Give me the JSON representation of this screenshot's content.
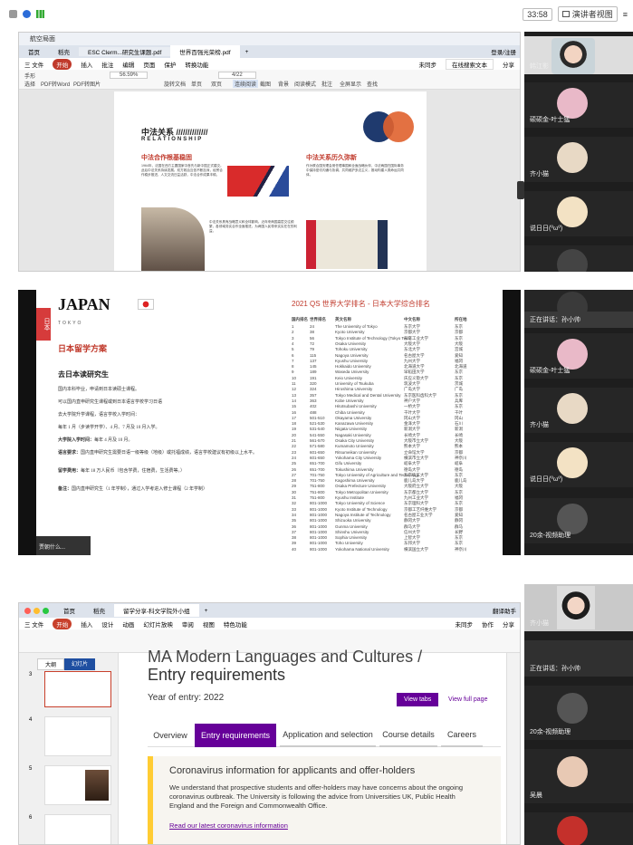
{
  "status": {
    "time": "33:58",
    "right_label": "演讲者视图"
  },
  "panel1": {
    "app_header": {
      "win_title": "航空局面",
      "tabs": [
        "首页",
        "稻壳",
        "ESC Clerm...研究生课题.pdf",
        "世界百强光荣榜.pdf"
      ],
      "right_btn": "登录/注册"
    },
    "menu": [
      "三 文件",
      "开始",
      "插入",
      "批注",
      "编辑",
      "页面",
      "保护",
      "转换功能"
    ],
    "menu_active": "开始",
    "menu_right": [
      "未同步",
      "在线搜索文本",
      "分享"
    ],
    "ribbon_left": [
      "手形",
      "选择",
      "PDF转Word",
      "PDF转图片"
    ],
    "zoom": "56.59%",
    "page_indicator": "4/22",
    "ribbon_right": [
      "旋转文档",
      "单页",
      "双页",
      "连续阅读",
      "截图",
      "背景",
      "阅读模式",
      "批注",
      "全屏显示",
      "查找"
    ],
    "doc": {
      "heading": "中法关系 //////////////",
      "subheading": "RELATIONSHIP",
      "col1_title": "中法合作根基稳固",
      "col1_text": "1964年，法国在西方主要国家中首先与新中国正式建交。此后中法关系持续发展。双方政治互信不断加深，经贸合作稳步推进，人文交流日益活跃，中法合作成果丰硕。",
      "col2_title": "中法关系历久弥新",
      "col2_text": "作为联合国安理会常任理事国和全面战略伙伴，中法两国在国际事务中保持密切沟通与协调，共同维护多边主义，推动构建人类命运共同体。",
      "bottom_text": "中法关系具有战略意义和全球影响。近年来两国高层交往频繁，各领域务实合作全面推进，为两国人民带来实实在在的利益。"
    },
    "participants": [
      {
        "name": "韩江影",
        "self": true
      },
      {
        "name": "硕硕金-叶士猛"
      },
      {
        "name": "齐小猫"
      },
      {
        "name": "说日日(ºωº)"
      }
    ]
  },
  "panel2": {
    "left": {
      "country": "JAPAN",
      "sub": "TOKYO",
      "side_label": "日本",
      "section": "日本留学方案",
      "h2": "去日本读研究生",
      "p1": "国内本科毕业，申请到日本读硕士课程。",
      "p2": "可以国内直申研究生课程或到日本语言学校学习日语",
      "p3": "去大学院升学课程，语言学校入学时间：",
      "p4": "每年 1 月（步读学开学）、4 月、7 月及 10 月入学。",
      "p5_label": "大学院入学时间：",
      "p5": "每年 4 月及 10 月。",
      "p6_label": "语言要求：",
      "p6": "国内直申研究生需要日语一级等级（地级）或托福成绩，语言学校建议有初级以上水平。",
      "p7_label": "留学费用：",
      "p7": "每年 18 万人民币（包含学费，住宿费，生活费等。）",
      "p8_label": "备注：",
      "p8": "国内直申研究生（1 年学制），通过入学考进入修士课程（2 年学制）",
      "speaker": "贾朝什么..."
    },
    "right": {
      "title": "2021 QS 世界大学排名 - 日本大学综合排名",
      "headers": [
        "国内排名",
        "世界排名",
        "英文名称",
        "中文名称",
        "所在地"
      ],
      "rows": [
        [
          "1",
          "24",
          "The University of Tokyo",
          "东京大学",
          "东京"
        ],
        [
          "2",
          "38",
          "Kyoto University",
          "京都大学",
          "京都"
        ],
        [
          "3",
          "56",
          "Tokyo Institute of Technology (Tokyo Tech)",
          "东京工业大学",
          "东京"
        ],
        [
          "4",
          "72",
          "Osaka University",
          "大阪大学",
          "大阪"
        ],
        [
          "5",
          "79",
          "Tohoku University",
          "东北大学",
          "宫城"
        ],
        [
          "6",
          "115",
          "Nagoya University",
          "名古屋大学",
          "爱知"
        ],
        [
          "7",
          "137",
          "Kyushu University",
          "九州大学",
          "福冈"
        ],
        [
          "8",
          "145",
          "Hokkaido University",
          "北海道大学",
          "北海道"
        ],
        [
          "9",
          "189",
          "Waseda University",
          "早稻田大学",
          "东京"
        ],
        [
          "10",
          "191",
          "Keio University",
          "庆应义塾大学",
          "东京"
        ],
        [
          "11",
          "320",
          "University of Tsukuba",
          "筑波大学",
          "茨城"
        ],
        [
          "12",
          "324",
          "Hiroshima University",
          "广岛大学",
          "广岛"
        ],
        [
          "13",
          "357",
          "Tokyo Medical and Dental University",
          "东京医科齿科大学",
          "东京"
        ],
        [
          "14",
          "363",
          "Kobe University",
          "神户大学",
          "兵库"
        ],
        [
          "15",
          "402",
          "Hitotsubashi University",
          "一桥大学",
          "东京"
        ],
        [
          "16",
          "488",
          "Chiba University",
          "千叶大学",
          "千叶"
        ],
        [
          "17",
          "501-510",
          "Okayama University",
          "冈山大学",
          "冈山"
        ],
        [
          "18",
          "521-530",
          "Kanazawa University",
          "金泽大学",
          "石川"
        ],
        [
          "19",
          "531-540",
          "Niigata University",
          "新潟大学",
          "新潟"
        ],
        [
          "20",
          "541-550",
          "Nagasaki University",
          "长崎大学",
          "长崎"
        ],
        [
          "21",
          "561-570",
          "Osaka City University",
          "大阪市立大学",
          "大阪"
        ],
        [
          "22",
          "571-580",
          "Kumamoto University",
          "熊本大学",
          "熊本"
        ],
        [
          "23",
          "601-650",
          "Ritsumeikan University",
          "立命馆大学",
          "京都"
        ],
        [
          "24",
          "601-650",
          "Yokohama City University",
          "横滨市立大学",
          "神奈川"
        ],
        [
          "25",
          "651-700",
          "Gifu University",
          "岐阜大学",
          "岐阜"
        ],
        [
          "26",
          "651-700",
          "Tokushima University",
          "德岛大学",
          "德岛"
        ],
        [
          "27",
          "701-750",
          "Tokyo University of Agriculture and Technology",
          "东京农工大学",
          "东京"
        ],
        [
          "28",
          "701-750",
          "Kagoshima University",
          "鹿儿岛大学",
          "鹿儿岛"
        ],
        [
          "29",
          "751-800",
          "Osaka Prefecture University",
          "大阪府立大学",
          "大阪"
        ],
        [
          "30",
          "751-800",
          "Tokyo Metropolitan University",
          "东京都立大学",
          "东京"
        ],
        [
          "31",
          "751-800",
          "Kyushu Institute",
          "九州工业大学",
          "福冈"
        ],
        [
          "32",
          "801-1000",
          "Tokyo University of Science",
          "东京理科大学",
          "东京"
        ],
        [
          "33",
          "801-1000",
          "Kyoto Institute of Technology",
          "京都工艺纤维大学",
          "京都"
        ],
        [
          "34",
          "801-1000",
          "Nagoya Institute of Technology",
          "名古屋工业大学",
          "爱知"
        ],
        [
          "35",
          "801-1000",
          "Shizuoka University",
          "静冈大学",
          "静冈"
        ],
        [
          "36",
          "801-1000",
          "Gunma University",
          "群马大学",
          "群马"
        ],
        [
          "37",
          "801-1000",
          "Shinshu University",
          "信州大学",
          "长野"
        ],
        [
          "38",
          "801-1000",
          "Sophia University",
          "上智大学",
          "东京"
        ],
        [
          "39",
          "801-1000",
          "Toho University",
          "东邦大学",
          "东京"
        ],
        [
          "40",
          "801-1000",
          "Yokohama National University",
          "横滨国立大学",
          "神奈川"
        ]
      ]
    },
    "participants": [
      {
        "name": "正在讲话：孙小帅"
      },
      {
        "name": "硕硕金-叶士猛"
      },
      {
        "name": "齐小猫"
      },
      {
        "name": "说日日(ºωº)"
      },
      {
        "name": "20余-视频助理"
      }
    ]
  },
  "panel3": {
    "app_header": {
      "tabs": [
        "首页",
        "稻壳",
        "留学分享-科文学院外小组"
      ],
      "right_btn": "翻译助手"
    },
    "menu": [
      "三 文件",
      "开始",
      "插入",
      "设计",
      "动画",
      "幻灯片放映",
      "审阅",
      "视图",
      "特色功能"
    ],
    "menu_active": "开始",
    "menu_right": [
      "未同步",
      "协作",
      "分享"
    ],
    "left_tabs": [
      "大纲",
      "幻灯片"
    ],
    "thumbs": [
      "3",
      "4",
      "5",
      "6"
    ],
    "slide": {
      "title_top": "MA Modern Languages and Cultures /",
      "title": "Entry requirements",
      "year": "Year of entry: 2022",
      "btn_tabs": "View tabs",
      "btn_full": "View full page",
      "nav": [
        "Overview",
        "Entry requirements",
        "Application and selection",
        "Course details",
        "Careers"
      ],
      "nav_active": "Entry requirements",
      "notice_title": "Coronavirus information for applicants and offer-holders",
      "notice_text": "We understand that prospective students and offer-holders may have concerns about the ongoing coronavirus outbreak. The University is following the advice from Universities UK, Public Health England and the Foreign and Commonwealth Office.",
      "notice_link": "Read our latest coronavirus information"
    },
    "participants": [
      {
        "name": "齐小猫",
        "self": true
      },
      {
        "name": "正在讲话：孙小帅"
      },
      {
        "name": "20余-视频助理"
      },
      {
        "name": "吴晨"
      }
    ]
  },
  "colors": {
    "pdf_accent": "#c0392b",
    "ppt_accent": "#c8402b",
    "manchester_purple": "#660099",
    "notice_yellow": "#ffcc33"
  }
}
